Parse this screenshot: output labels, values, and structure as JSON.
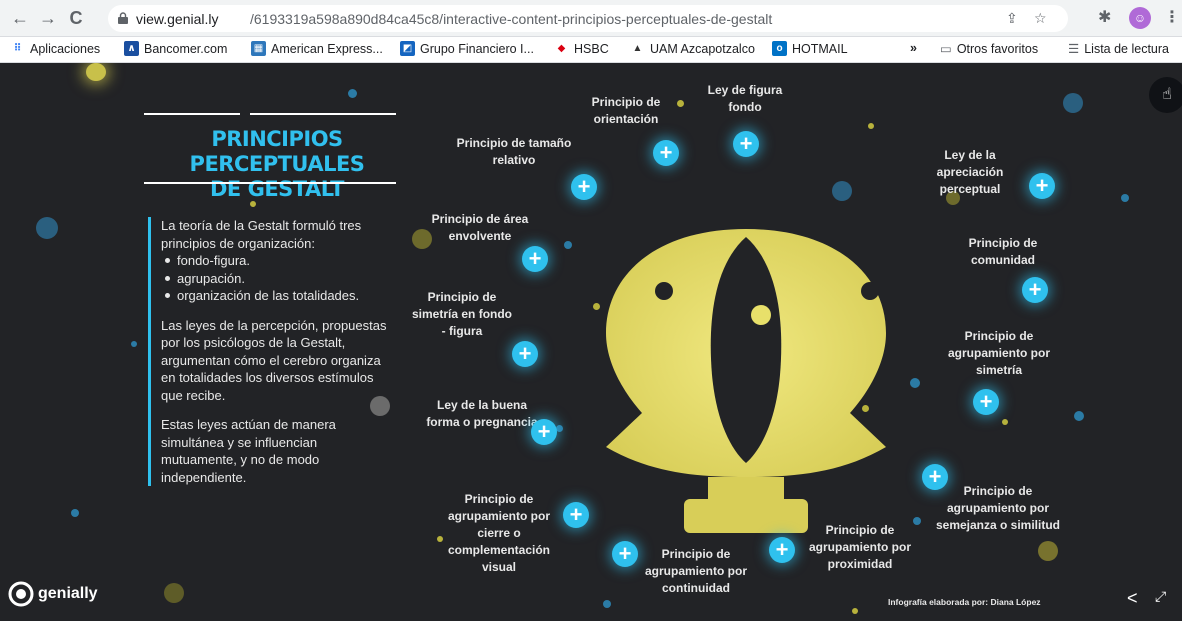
{
  "browser": {
    "url_host": "view.genial.ly",
    "url_path": "/6193319a598a890d84ca45c8/interactive-content-principios-perceptuales-de-gestalt",
    "bookmarks": [
      {
        "label": "Aplicaciones",
        "color": "#4285f4"
      },
      {
        "label": "Bancomer.com",
        "color": "#1a4fa0"
      },
      {
        "label": "American Express...",
        "color": "#2e77bb"
      },
      {
        "label": "Grupo Financiero I...",
        "color": "#1565c0"
      },
      {
        "label": "HSBC",
        "color": "#db0011"
      },
      {
        "label": "UAM Azcapotzalco",
        "color": "#333333"
      },
      {
        "label": "HOTMAIL",
        "color": "#0072c6"
      }
    ],
    "bookmarks_overflow": "»",
    "other_bookmarks": "Otros favoritos",
    "reading_list": "Lista de lectura"
  },
  "infographic": {
    "title_line1": "PRINCIPIOS PERCEPTUALES",
    "title_line2": "DE GESTALT",
    "title_color": "#31c0ee",
    "accent_color": "#2fc1ee",
    "figure_color": "#e8e06a",
    "intro": "La teoría de la Gestalt formuló tres principios de organización:",
    "bullets": [
      "fondo-figura.",
      "agrupación.",
      "organización de las totalidades."
    ],
    "para2": "Las leyes de la percepción, propuestas por los psicólogos de la Gestalt, argumentan cómo el cerebro organiza en totalidades los diversos estímulos que recibe.",
    "para3": "Estas leyes actúan de manera simultánea y se influencian mutuamente, y no de modo independiente.",
    "labels": {
      "orientacion": "Principio de orientación",
      "figura_fondo": "Ley de figura fondo",
      "tamano": "Principio de tamaño relativo",
      "apreciacion": "Ley de la apreciación perceptual",
      "area": "Principio de área envolvente",
      "comunidad": "Principio de comunidad",
      "simetria_fondo": "Principio de simetría en fondo - figura",
      "agrup_simetria": "Principio de agrupamiento por simetría",
      "buena_forma": "Ley de la buena forma o pregnancia",
      "semejanza": "Principio de agrupamiento por semejanza o similitud",
      "cierre": "Principio de agrupamiento por cierre o complementación visual",
      "continuidad": "Principio de agrupamiento por continuidad",
      "proximidad": "Principio de agrupamiento por proximidad"
    },
    "plus_symbol": "+",
    "credit": "Infografía elaborada por: Diana López",
    "brand": "genially"
  }
}
